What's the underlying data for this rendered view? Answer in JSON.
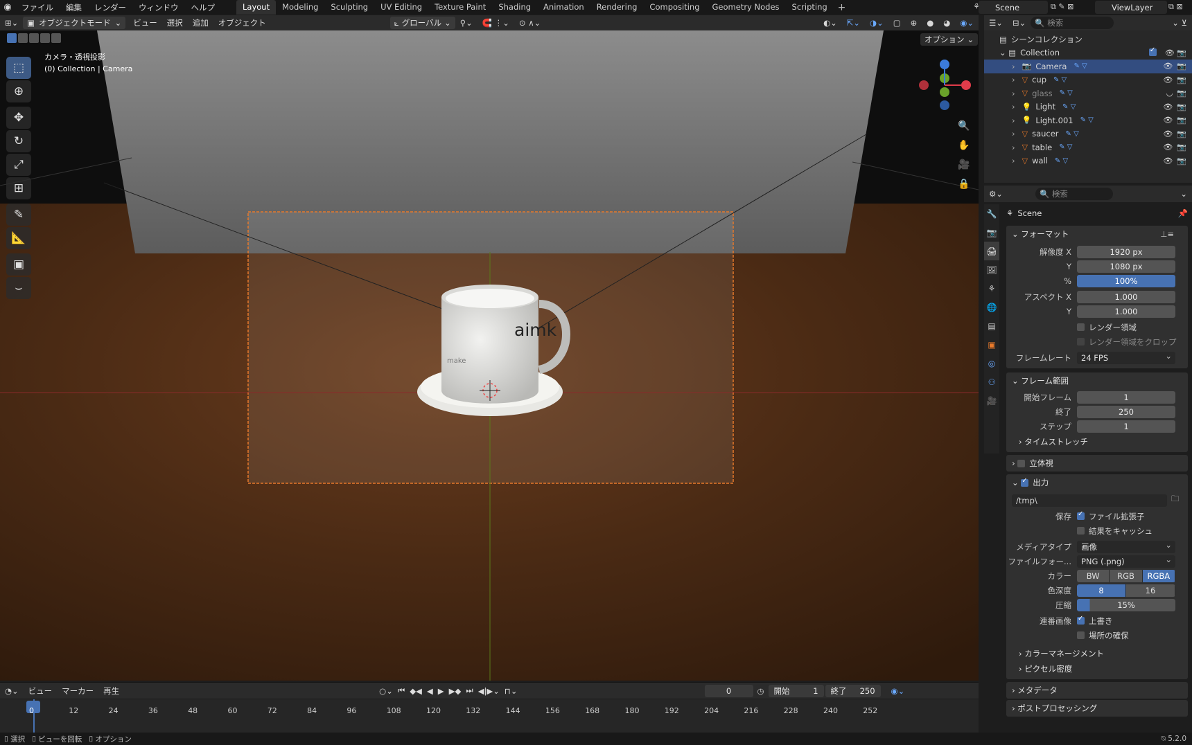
{
  "topbar": {
    "menus": [
      "ファイル",
      "編集",
      "レンダー",
      "ウィンドウ",
      "ヘルプ"
    ],
    "workspaces": [
      "Layout",
      "Modeling",
      "Sculpting",
      "UV Editing",
      "Texture Paint",
      "Shading",
      "Animation",
      "Rendering",
      "Compositing",
      "Geometry Nodes",
      "Scripting"
    ],
    "scene": "Scene",
    "view_layer": "ViewLayer"
  },
  "viewport_header": {
    "mode": "オブジェクトモード",
    "menus": [
      "ビュー",
      "選択",
      "追加",
      "オブジェクト"
    ],
    "transform": "グローバル",
    "options": "オプション"
  },
  "viewport": {
    "camera_label": "カメラ・透視投影",
    "collection_label": "(0) Collection | Camera",
    "mug_text": "aimk",
    "mug_small": "make"
  },
  "outliner": {
    "search_placeholder": "検索",
    "root": "シーンコレクション",
    "collection": "Collection",
    "items": [
      {
        "name": "Camera",
        "selected": true
      },
      {
        "name": "cup"
      },
      {
        "name": "glass",
        "dim": true
      },
      {
        "name": "Light"
      },
      {
        "name": "Light.001"
      },
      {
        "name": "saucer"
      },
      {
        "name": "table"
      },
      {
        "name": "wall"
      }
    ]
  },
  "properties": {
    "search_placeholder": "検索",
    "context": "Scene",
    "format": {
      "title": "フォーマット",
      "res_x_label": "解像度 X",
      "res_x": "1920 px",
      "res_y_label": "Y",
      "res_y": "1080 px",
      "pct_label": "%",
      "pct": "100%",
      "aspect_x_label": "アスペクト X",
      "aspect_x": "1.000",
      "aspect_y_label": "Y",
      "aspect_y": "1.000",
      "render_region": "レンダー領域",
      "crop": "レンダー領域をクロップ",
      "fps_label": "フレームレート",
      "fps": "24 FPS"
    },
    "frame_range": {
      "title": "フレーム範囲",
      "start_label": "開始フレーム",
      "start": "1",
      "end_label": "終了",
      "end": "250",
      "step_label": "ステップ",
      "step": "1",
      "time_stretch": "タイムストレッチ"
    },
    "stereo": "立体視",
    "output": {
      "title": "出力",
      "path": "/tmp\\",
      "save_label": "保存",
      "file_ext": "ファイル拡張子",
      "cache": "結果をキャッシュ",
      "media_label": "メディアタイプ",
      "media": "画像",
      "format_label": "ファイルフォー...",
      "format": "PNG (.png)",
      "color_label": "カラー",
      "colors": [
        "BW",
        "RGB",
        "RGBA"
      ],
      "depth_label": "色深度",
      "depths": [
        "8",
        "16"
      ],
      "compress_label": "圧縮",
      "compress": "15%",
      "seq_label": "連番画像",
      "overwrite": "上書き",
      "placeholders": "場所の確保"
    },
    "color_mgmt": "カラーマネージメント",
    "pixel_density": "ピクセル密度",
    "metadata": "メタデータ",
    "post": "ポストプロセッシング"
  },
  "timeline": {
    "menus": [
      "ビュー",
      "マーカー",
      "再生"
    ],
    "current": "0",
    "start_label": "開始",
    "start": "1",
    "end_label": "終了",
    "end": "250",
    "ticks": [
      "0",
      "12",
      "24",
      "36",
      "48",
      "60",
      "72",
      "84",
      "96",
      "108",
      "120",
      "132",
      "144",
      "156",
      "168",
      "180",
      "192",
      "204",
      "216",
      "228",
      "240",
      "252"
    ]
  },
  "status": {
    "select": "選択",
    "rotate": "ビューを回転",
    "options": "オプション",
    "version": "5.2.0"
  }
}
